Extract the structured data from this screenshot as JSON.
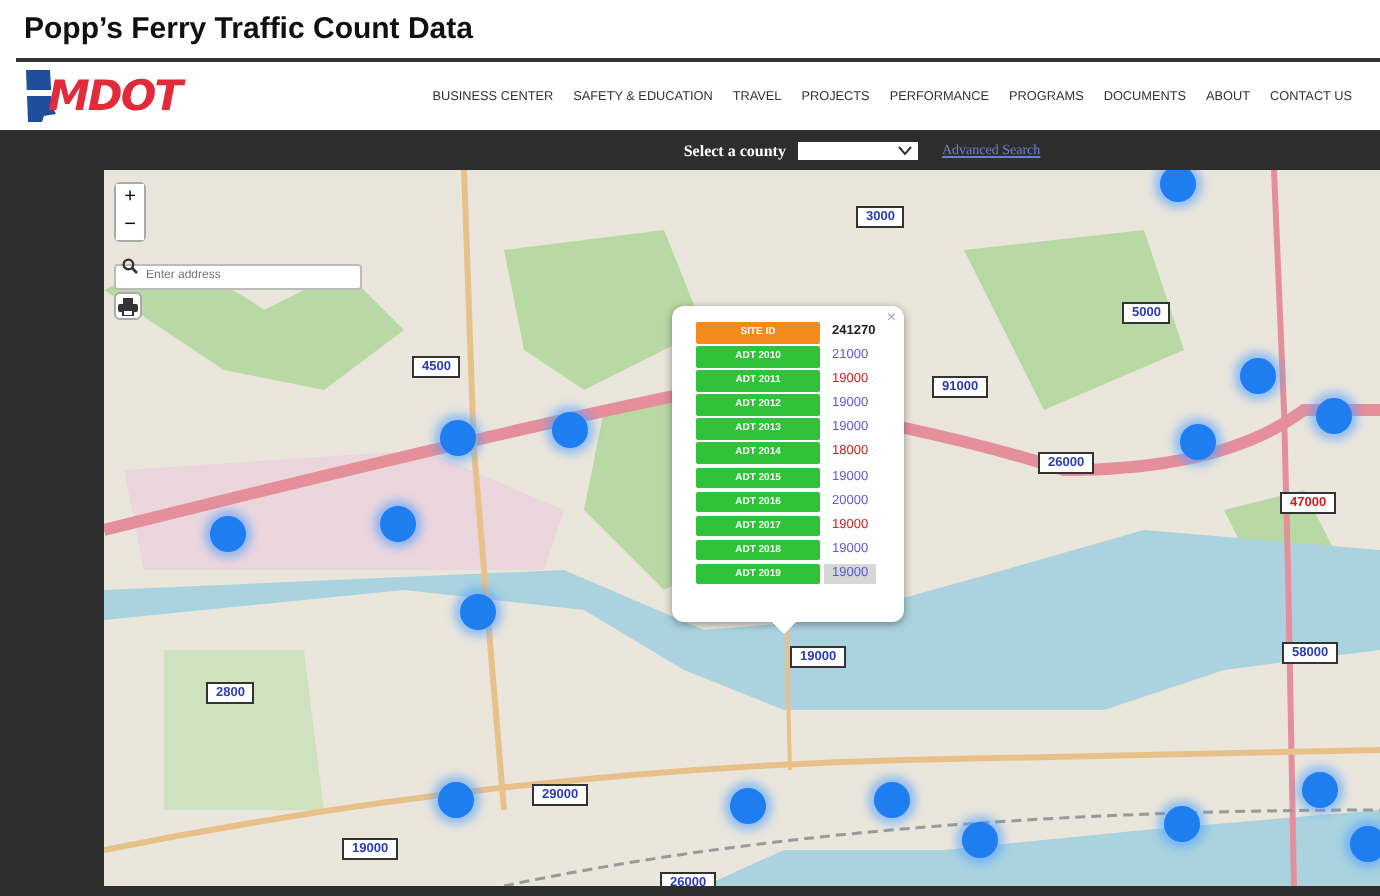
{
  "page_title": "Popp’s Ferry Traffic Count Data",
  "header": {
    "logo": "MDOT",
    "nav": [
      "BUSINESS CENTER",
      "SAFETY & EDUCATION",
      "TRAVEL",
      "PROJECTS",
      "PERFORMANCE",
      "PROGRAMS",
      "DOCUMENTS",
      "ABOUT",
      "CONTACT US"
    ]
  },
  "county_bar": {
    "label": "Select a county",
    "link": "Advanced Search"
  },
  "map": {
    "zoom_in": "+",
    "zoom_out": "−",
    "address_search": {
      "placeholder": "Enter address"
    },
    "count_labels": [
      {
        "text": "3000",
        "color": "#2a3bb8"
      },
      {
        "text": "4500",
        "color": "#2a3bb8"
      },
      {
        "text": "5000",
        "color": "#2a3bb8"
      },
      {
        "text": "91000",
        "color": "#2a3bb8"
      },
      {
        "text": "26000",
        "color": "#2a3bb8"
      },
      {
        "text": "47000",
        "color": "#d02020"
      },
      {
        "text": "58000",
        "color": "#2a3bb8"
      },
      {
        "text": "19000",
        "color": "#2a3bb8"
      },
      {
        "text": "2800",
        "color": "#2a3bb8"
      },
      {
        "text": "29000",
        "color": "#2a3bb8"
      },
      {
        "text": "19000",
        "color": "#2a3bb8"
      },
      {
        "text": "26000",
        "color": "#2a3bb8"
      }
    ],
    "popup": {
      "close": "×",
      "rows": [
        {
          "kind": "site",
          "label": "SITE ID",
          "value": "241270",
          "selected": false
        },
        {
          "kind": "adt",
          "label": "ADT 2010",
          "value": "21000",
          "color": "#5a5ad8",
          "selected": false
        },
        {
          "kind": "adt",
          "label": "ADT 2011",
          "value": "19000",
          "color": "#d02020",
          "selected": false
        },
        {
          "kind": "adt",
          "label": "ADT 2012",
          "value": "19000",
          "color": "#5a5ad8",
          "selected": false
        },
        {
          "kind": "adt",
          "label": "ADT 2013",
          "value": "19000",
          "color": "#5a5ad8",
          "selected": false
        },
        {
          "kind": "adt",
          "label": "ADT 2014",
          "value": "18000",
          "color": "#d02020",
          "selected": false
        },
        {
          "kind": "adt",
          "label": "ADT 2015",
          "value": "19000",
          "color": "#5a5ad8",
          "selected": false
        },
        {
          "kind": "adt",
          "label": "ADT 2016",
          "value": "20000",
          "color": "#5a5ad8",
          "selected": false
        },
        {
          "kind": "adt",
          "label": "ADT 2017",
          "value": "19000",
          "color": "#d02020",
          "selected": false
        },
        {
          "kind": "adt",
          "label": "ADT 2018",
          "value": "19000",
          "color": "#5a5ad8",
          "selected": false
        },
        {
          "kind": "adt",
          "label": "ADT 2019",
          "value": "19000",
          "color": "#5a5ad8",
          "selected": true
        }
      ]
    }
  }
}
